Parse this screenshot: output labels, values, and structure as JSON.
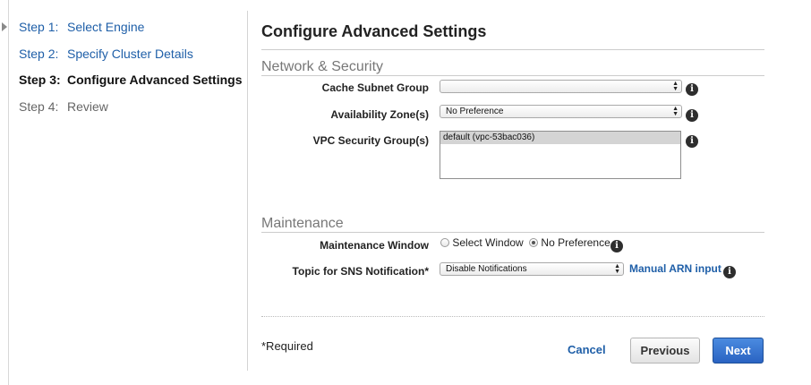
{
  "wizard": {
    "steps": [
      {
        "num": "Step 1:",
        "label": "Select Engine"
      },
      {
        "num": "Step 2:",
        "label": "Specify Cluster Details"
      },
      {
        "num": "Step 3:",
        "label": "Configure Advanced Settings"
      },
      {
        "num": "Step 4:",
        "label": "Review"
      }
    ]
  },
  "page": {
    "title": "Configure Advanced Settings"
  },
  "network": {
    "section_title": "Network & Security",
    "cache_subnet_label": "Cache Subnet Group",
    "cache_subnet_value": "",
    "availability_zone_label": "Availability Zone(s)",
    "availability_zone_value": "No Preference",
    "vpc_sg_label": "VPC Security Group(s)",
    "vpc_sg_options": [
      "default (vpc-53bac036)"
    ]
  },
  "maintenance": {
    "section_title": "Maintenance",
    "window_label": "Maintenance Window",
    "radio_select_window": "Select Window",
    "radio_no_preference": "No Preference",
    "sns_label": "Topic for SNS Notification*",
    "sns_value": "Disable Notifications",
    "manual_arn_link": "Manual ARN input"
  },
  "footer": {
    "required_note": "*Required",
    "cancel_label": "Cancel",
    "previous_label": "Previous",
    "next_label": "Next"
  },
  "icons": {
    "info": "i"
  },
  "colors": {
    "link": "#1f5fa8",
    "primary_button": "#2a63c2"
  }
}
